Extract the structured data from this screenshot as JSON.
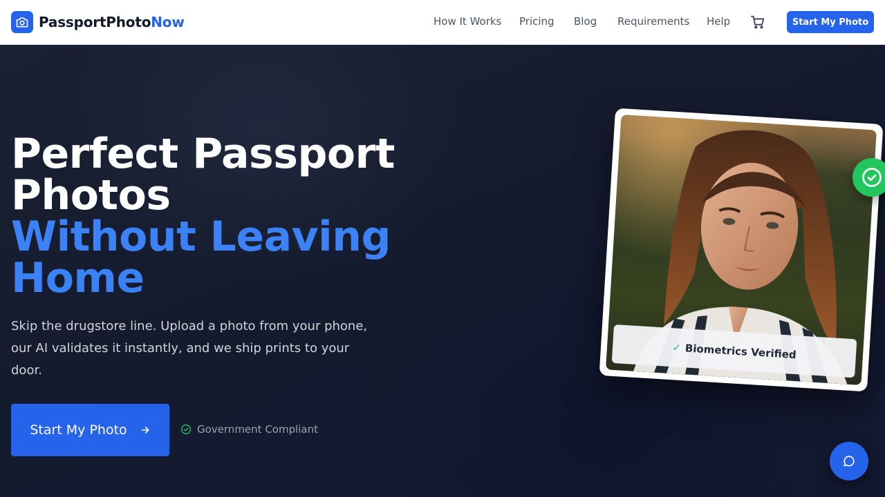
{
  "brand": {
    "name": "PassportPhoto",
    "accent": "Now",
    "icon": "camera-icon",
    "color": "#2563eb"
  },
  "nav": {
    "links": [
      "How It Works",
      "Pricing",
      "Blog",
      "Requirements",
      "Help"
    ],
    "cart_icon": "cart-icon",
    "cta_label": "Start My Photo"
  },
  "hero": {
    "title_line1": "Perfect Passport",
    "title_line2": "Photos",
    "title_accent_line1": "Without Leaving",
    "title_accent_line2": "Home",
    "subtitle": "Skip the drugstore line. Upload a photo from your phone, our AI validates it instantly, and we ship prints to your door.",
    "cta_label": "Start My Photo",
    "cta_icon": "arrow-right-icon",
    "compliance_text": "Government Compliant",
    "compliance_icon": "check-circle-icon"
  },
  "photo_card": {
    "badge_text": "Biometrics Verified",
    "badge_tick": "✓",
    "verified_icon": "check-circle-icon",
    "success_color": "#22c55e"
  },
  "chat": {
    "icon": "chat-bubble-icon"
  }
}
